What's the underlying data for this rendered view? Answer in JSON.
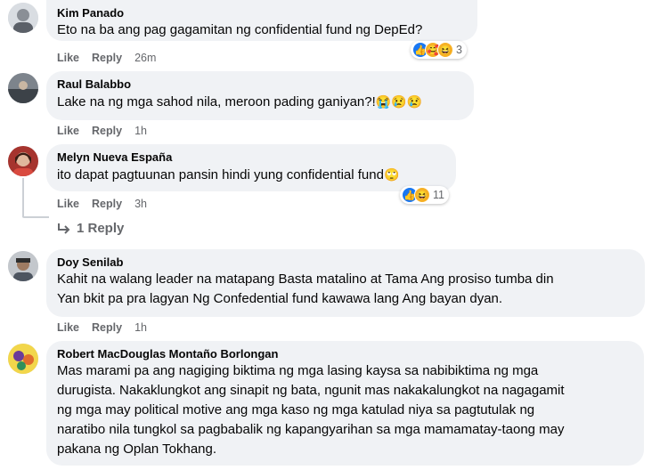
{
  "comments": [
    {
      "author": "Kim Panado",
      "text": "Eto na ba ang pag gagamitan ng confidential fund ng DepEd?",
      "like": "Like",
      "reply": "Reply",
      "time": "26m",
      "reaction_count": "3"
    },
    {
      "author": "Raul Balabbo",
      "text": "Lake na ng mga sahod nila, meroon pading ganiyan?!",
      "emojis": "😭😢😢",
      "like": "Like",
      "reply": "Reply",
      "time": "1h"
    },
    {
      "author": "Melyn Nueva España",
      "text": "ito dapat pagtuunan pansin hindi yung confidential fund",
      "emojis": "🙄",
      "like": "Like",
      "reply": "Reply",
      "time": "3h",
      "reaction_count": "11",
      "replies_label": "1 Reply"
    },
    {
      "author": "Doy Senilab",
      "text_lines": [
        "Kahit na walang leader na matapang Basta matalino at Tama Ang prosiso tumba din",
        "Yan bkit pa pra lagyan Ng Confedential fund kawawa lang Ang bayan dyan."
      ],
      "like": "Like",
      "reply": "Reply",
      "time": "1h"
    },
    {
      "author": "Robert MacDouglas Montaño Borlongan",
      "text_lines": [
        "Mas marami pa ang nagiging biktima ng mga lasing kaysa sa nabibiktima ng mga",
        "durugista. Nakaklungkot ang sinapit ng bata, ngunit mas nakakalungkot na nagagamit",
        "ng mga may political motive ang mga kaso ng mga katulad niya sa pagtutulak ng",
        "naratibo nila tungkol sa pagbabalik ng kapangyarihan sa mga mamamatay-taong may",
        "pakana ng Oplan Tokhang."
      ]
    }
  ],
  "icons": {
    "like": "like-reaction-icon",
    "haha": "haha-reaction-icon",
    "care": "care-reaction-icon",
    "reply_arrow": "reply-arrow-icon"
  },
  "colors": {
    "bubble": "#f0f2f5",
    "meta": "#65676b",
    "like_blue": "#1877f2"
  }
}
